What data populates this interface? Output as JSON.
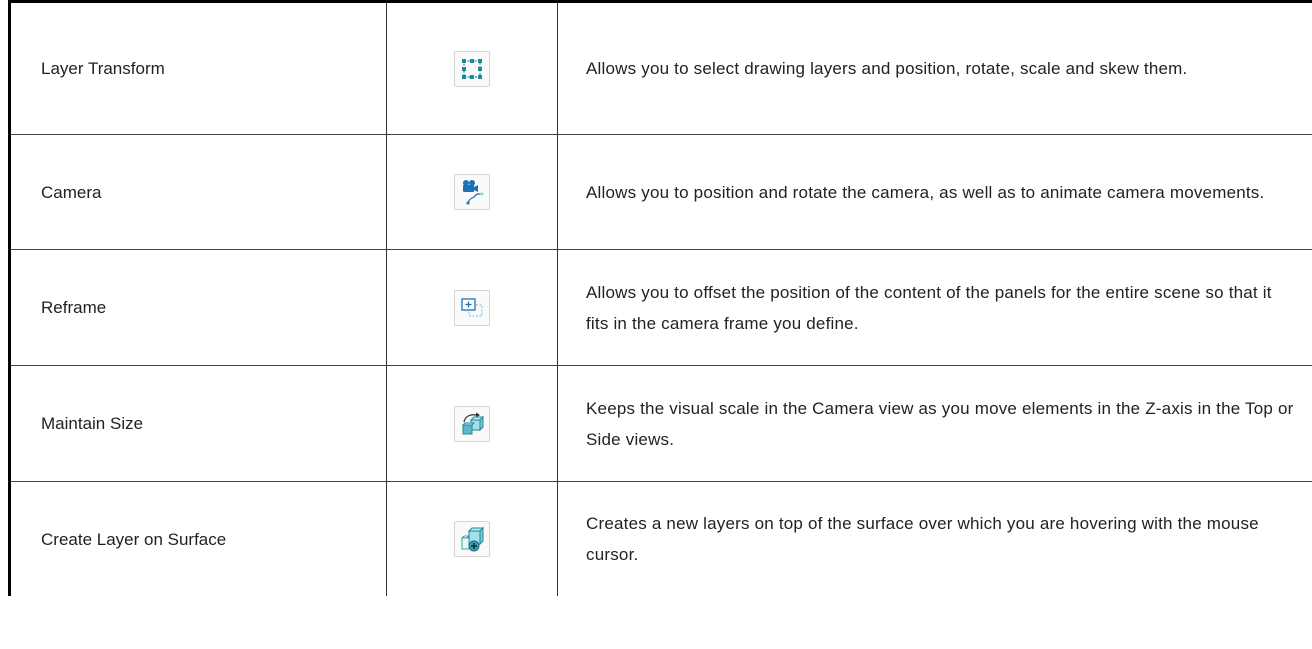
{
  "rows": [
    {
      "name": "Layer Transform",
      "icon": "layer-transform-icon",
      "description": "Allows you to select drawing layers and position, rotate, scale and skew them."
    },
    {
      "name": "Camera",
      "icon": "camera-icon",
      "description": "Allows you to position and rotate the camera, as well as to animate camera movements."
    },
    {
      "name": "Reframe",
      "icon": "reframe-icon",
      "description": "Allows you to offset the position of the content of the panels for the entire scene so that it fits in the camera frame you define."
    },
    {
      "name": "Maintain Size",
      "icon": "maintain-size-icon",
      "description": "Keeps the visual scale in the Camera view as you move elements in the Z-axis in the Top or Side views."
    },
    {
      "name": "Create Layer on Surface",
      "icon": "create-layer-on-surface-icon",
      "description": "Creates a new layers on top of the surface over which you are hovering with the mouse cursor."
    }
  ],
  "colors": {
    "icon_teal": "#1b8a9a",
    "icon_blue": "#1f6fb5",
    "icon_light": "#bfe9f0",
    "border": "#333333"
  }
}
